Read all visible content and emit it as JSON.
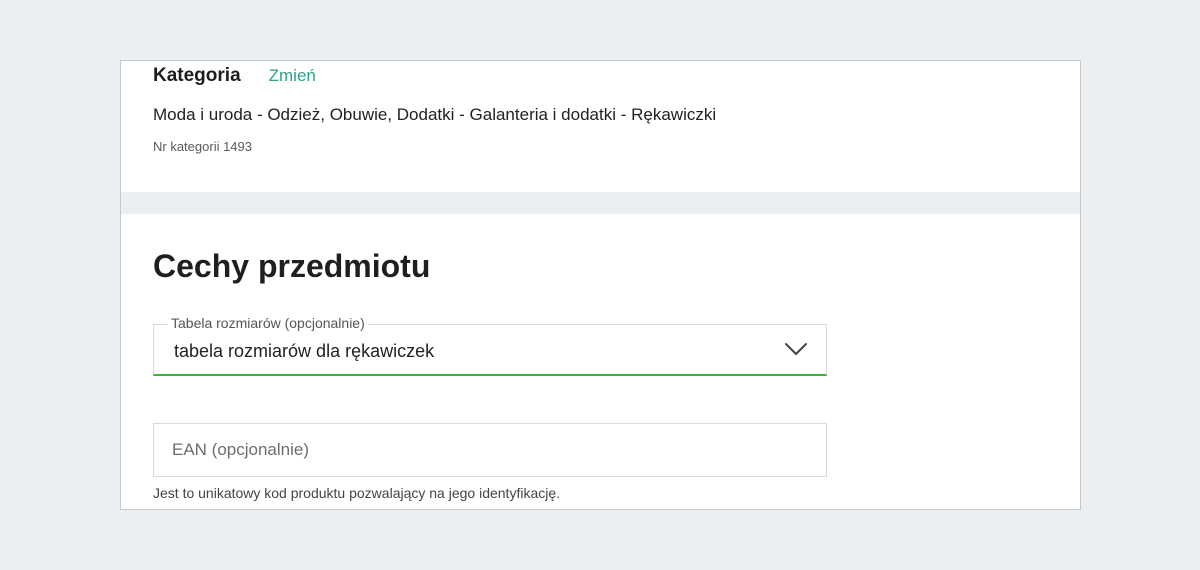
{
  "category": {
    "title": "Kategoria",
    "change_label": "Zmień",
    "path": "Moda i uroda - Odzież, Obuwie, Dodatki - Galanteria i dodatki - Rękawiczki",
    "number": "Nr kategorii 1493"
  },
  "features": {
    "title": "Cechy przedmiotu",
    "size_table": {
      "label": "Tabela rozmiarów (opcjonalnie)",
      "value": "tabela rozmiarów dla rękawiczek",
      "icon": "chevron-down-icon"
    },
    "ean": {
      "placeholder": "EAN (opcjonalnie)",
      "value": "",
      "helper": "Jest to unikatowy kod produktu pozwalający na jego identyfikację."
    }
  },
  "colors": {
    "accent_link": "#2aa38c",
    "active_underline": "#36b536",
    "background": "#eceff2"
  }
}
